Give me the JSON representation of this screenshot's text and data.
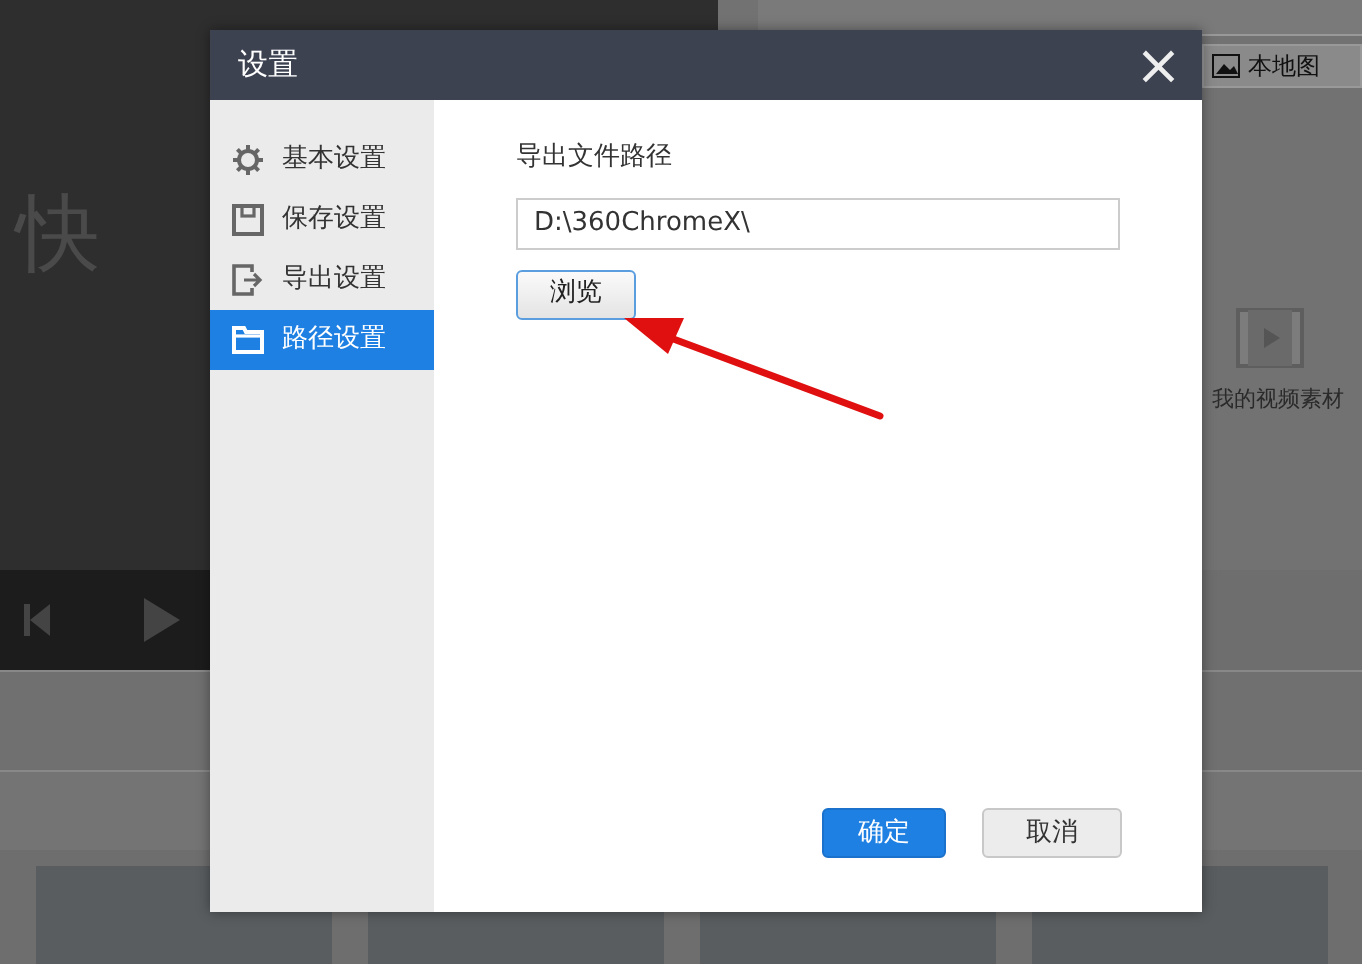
{
  "background": {
    "logo_text": "快",
    "library_button": "本地图",
    "media_label": "我的视频素材"
  },
  "dialog": {
    "title": "设置",
    "close": "×",
    "sidebar": [
      {
        "kind": "gear",
        "label": "基本设置",
        "selected": false
      },
      {
        "kind": "save",
        "label": "保存设置",
        "selected": false
      },
      {
        "kind": "export",
        "label": "导出设置",
        "selected": false
      },
      {
        "kind": "folder",
        "label": "路径设置",
        "selected": true
      }
    ],
    "section_label": "导出文件路径",
    "path_value": "D:\\360ChromeX\\",
    "browse": "浏览",
    "buttons": [
      {
        "kind": "primary",
        "label": "确定"
      },
      {
        "kind": "secondary",
        "label": "取消"
      }
    ]
  }
}
